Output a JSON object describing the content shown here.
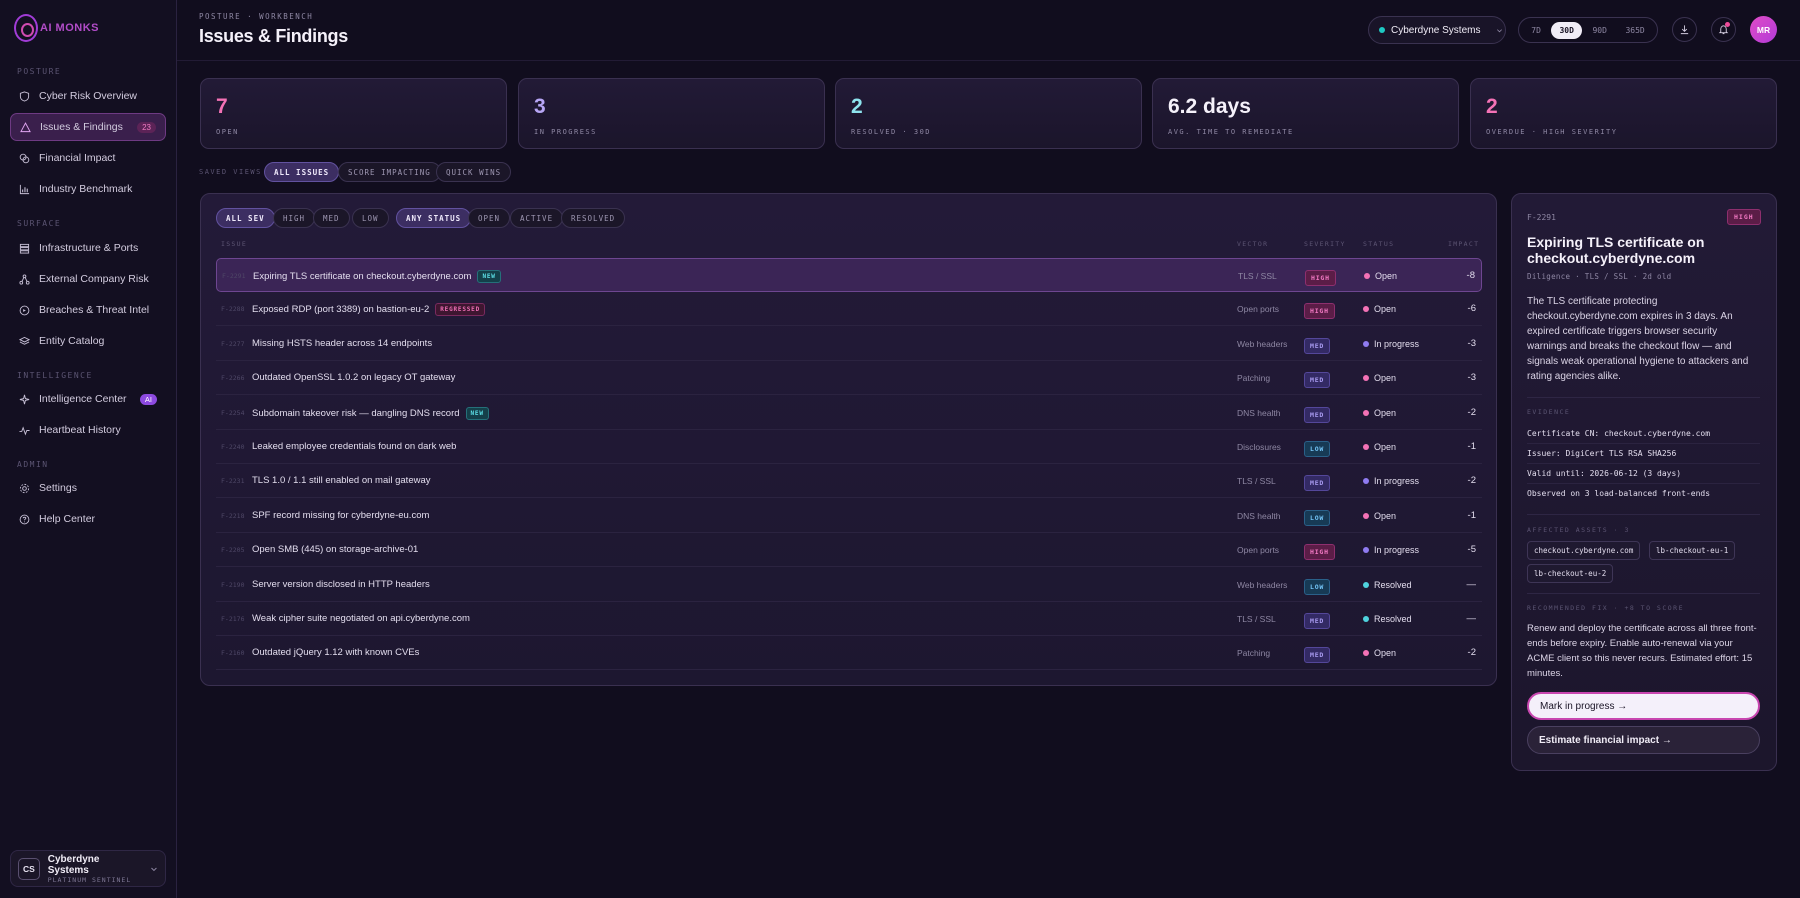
{
  "sidebar": {
    "logo": "AI MONKS",
    "sections": {
      "posture": "POSTURE",
      "surface": "SURFACE",
      "intelligence": "INTELLIGENCE",
      "admin": "ADMIN"
    },
    "items": [
      {
        "label": "Cyber Risk Overview",
        "icon": "shield-icon"
      },
      {
        "label": "Issues & Findings",
        "icon": "warning-triangle-icon",
        "badge": "23"
      },
      {
        "label": "Financial Impact",
        "icon": "coins-icon"
      },
      {
        "label": "Industry Benchmark",
        "icon": "bar-chart-icon"
      },
      {
        "label": "Infrastructure & Ports",
        "icon": "server-stack-icon"
      },
      {
        "label": "External Company Risk",
        "icon": "network-nodes-icon"
      },
      {
        "label": "Breaches & Threat Intel",
        "icon": "target-icon"
      },
      {
        "label": "Entity Catalog",
        "icon": "layers-icon"
      },
      {
        "label": "Intelligence Center",
        "icon": "sparkle-icon",
        "badge": "AI"
      },
      {
        "label": "Heartbeat History",
        "icon": "pulse-icon"
      },
      {
        "label": "Settings",
        "icon": "gear-icon"
      },
      {
        "label": "Help Center",
        "icon": "help-circle-icon"
      }
    ],
    "org": {
      "initials": "CS",
      "name": "Cyberdyne Systems",
      "tier": "PLATINUM SENTINEL"
    }
  },
  "header": {
    "breadcrumb": "POSTURE · WORKBENCH",
    "title": "Issues & Findings",
    "org_select": "Cyberdyne Systems",
    "ranges": [
      "7D",
      "30D",
      "90D",
      "365D"
    ],
    "range_selected": "30D",
    "avatar": "MR"
  },
  "kpis": [
    {
      "value": "7",
      "label": "OPEN",
      "color": "#f472b6"
    },
    {
      "value": "3",
      "label": "IN PROGRESS",
      "color": "#b7a6f5"
    },
    {
      "value": "2",
      "label": "RESOLVED · 30D",
      "color": "#8ee4ee"
    },
    {
      "value": "6.2 days",
      "label": "AVG. TIME TO REMEDIATE",
      "color": "#f5f1fa"
    },
    {
      "value": "2",
      "label": "OVERDUE · HIGH SEVERITY",
      "color": "#f472b6"
    }
  ],
  "saved_views": {
    "label": "SAVED VIEWS",
    "items": [
      "ALL ISSUES",
      "SCORE IMPACTING",
      "QUICK WINS"
    ]
  },
  "filters": {
    "severity": [
      "ALL SEV",
      "HIGH",
      "MED",
      "LOW"
    ],
    "status": [
      "ANY STATUS",
      "OPEN",
      "ACTIVE",
      "RESOLVED"
    ]
  },
  "table": {
    "headers": {
      "issue": "ISSUE",
      "vector": "VECTOR",
      "severity": "SEVERITY",
      "status": "STATUS",
      "impact": "IMPACT"
    },
    "rows": [
      {
        "id": "F-2291",
        "title": "Expiring TLS certificate on checkout.cyberdyne.com",
        "tag": "NEW",
        "vector": "TLS / SSL",
        "severity": "HIGH",
        "status": "Open",
        "impact": "-8"
      },
      {
        "id": "F-2288",
        "title": "Exposed RDP (port 3389) on bastion-eu-2",
        "tag": "REGRESSED",
        "vector": "Open ports",
        "severity": "HIGH",
        "status": "Open",
        "impact": "-6"
      },
      {
        "id": "F-2277",
        "title": "Missing HSTS header across 14 endpoints",
        "tag": "",
        "vector": "Web headers",
        "severity": "MED",
        "status": "In progress",
        "impact": "-3"
      },
      {
        "id": "F-2266",
        "title": "Outdated OpenSSL 1.0.2 on legacy OT gateway",
        "tag": "",
        "vector": "Patching",
        "severity": "MED",
        "status": "Open",
        "impact": "-3"
      },
      {
        "id": "F-2254",
        "title": "Subdomain takeover risk — dangling DNS record",
        "tag": "NEW",
        "vector": "DNS health",
        "severity": "MED",
        "status": "Open",
        "impact": "-2"
      },
      {
        "id": "F-2240",
        "title": "Leaked employee credentials found on dark web",
        "tag": "",
        "vector": "Disclosures",
        "severity": "LOW",
        "status": "Open",
        "impact": "-1"
      },
      {
        "id": "F-2231",
        "title": "TLS 1.0 / 1.1 still enabled on mail gateway",
        "tag": "",
        "vector": "TLS / SSL",
        "severity": "MED",
        "status": "In progress",
        "impact": "-2"
      },
      {
        "id": "F-2218",
        "title": "SPF record missing for cyberdyne-eu.com",
        "tag": "",
        "vector": "DNS health",
        "severity": "LOW",
        "status": "Open",
        "impact": "-1"
      },
      {
        "id": "F-2205",
        "title": "Open SMB (445) on storage-archive-01",
        "tag": "",
        "vector": "Open ports",
        "severity": "HIGH",
        "status": "In progress",
        "impact": "-5"
      },
      {
        "id": "F-2190",
        "title": "Server version disclosed in HTTP headers",
        "tag": "",
        "vector": "Web headers",
        "severity": "LOW",
        "status": "Resolved",
        "impact": "—"
      },
      {
        "id": "F-2176",
        "title": "Weak cipher suite negotiated on api.cyberdyne.com",
        "tag": "",
        "vector": "TLS / SSL",
        "severity": "MED",
        "status": "Resolved",
        "impact": "—"
      },
      {
        "id": "F-2160",
        "title": "Outdated jQuery 1.12 with known CVEs",
        "tag": "",
        "vector": "Patching",
        "severity": "MED",
        "status": "Open",
        "impact": "-2"
      }
    ]
  },
  "detail": {
    "id": "F-2291",
    "severity": "HIGH",
    "title": "Expiring TLS certificate on checkout.cyberdyne.com",
    "meta": "Diligence · TLS / SSL · 2d old",
    "description": "The TLS certificate protecting checkout.cyberdyne.com expires in 3 days. An expired certificate triggers browser security warnings and breaks the checkout flow — and signals weak operational hygiene to attackers and rating agencies alike.",
    "evidence_label": "EVIDENCE",
    "evidence": [
      "Certificate CN: checkout.cyberdyne.com",
      "Issuer: DigiCert TLS RSA SHA256",
      "Valid until: 2026-06-12 (3 days)",
      "Observed on 3 load-balanced front-ends"
    ],
    "assets_label": "AFFECTED ASSETS · 3",
    "assets": [
      "checkout.cyberdyne.com",
      "lb-checkout-eu-1",
      "lb-checkout-eu-2"
    ],
    "fix_label": "RECOMMENDED FIX · +8 TO SCORE",
    "fix": "Renew and deploy the certificate across all three front-ends before expiry. Enable auto-renewal via your ACME client so this never recurs. Estimated effort: 15 minutes.",
    "primary_action": "Mark in progress →",
    "secondary_action": "Estimate financial impact →"
  },
  "colors": {
    "accent": "#c846b0",
    "open": "#f472b6",
    "in_progress": "#8f7bf0",
    "resolved": "#4fd3de"
  }
}
